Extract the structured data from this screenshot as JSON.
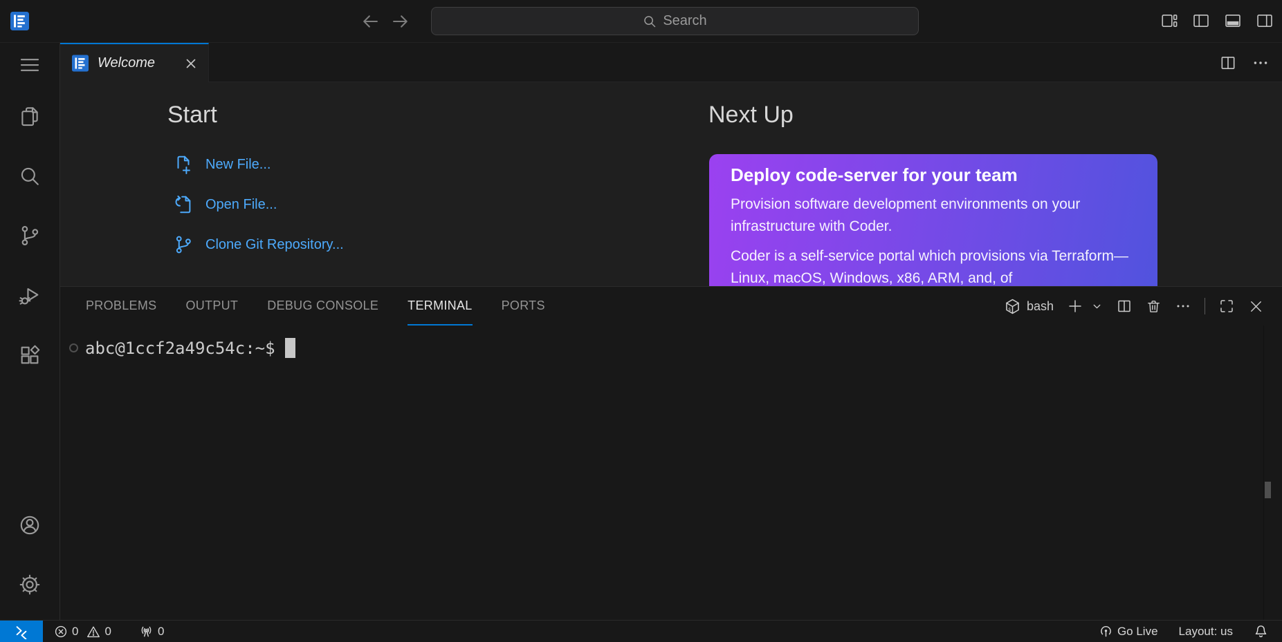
{
  "titlebar": {
    "search_label": "Search",
    "window_controls": [
      "customize-layout",
      "toggle-primary-sidebar",
      "toggle-panel",
      "toggle-secondary-sidebar"
    ]
  },
  "activity_bar": {
    "items": [
      "menu",
      "explorer",
      "search",
      "source-control",
      "run-and-debug",
      "extensions"
    ],
    "bottom_items": [
      "accounts",
      "settings"
    ]
  },
  "editor": {
    "tab": {
      "label": "Welcome"
    }
  },
  "welcome": {
    "start_heading": "Start",
    "start_links": [
      {
        "label": "New File...",
        "icon": "new-file-icon"
      },
      {
        "label": "Open File...",
        "icon": "open-file-icon"
      },
      {
        "label": "Clone Git Repository...",
        "icon": "git-branch-icon"
      }
    ],
    "next_up_heading": "Next Up",
    "card": {
      "title": "Deploy code-server for your team",
      "paragraph_1": "Provision software development environments on your infrastructure with Coder.",
      "paragraph_2": "Coder is a self-service portal which provisions via Terraform—Linux, macOS, Windows, x86, ARM, and, of"
    }
  },
  "panel": {
    "tabs": [
      {
        "label": "PROBLEMS",
        "active": false
      },
      {
        "label": "OUTPUT",
        "active": false
      },
      {
        "label": "DEBUG CONSOLE",
        "active": false
      },
      {
        "label": "TERMINAL",
        "active": true
      },
      {
        "label": "PORTS",
        "active": false
      }
    ],
    "shell_label": "bash"
  },
  "terminal": {
    "prompt": "abc@1ccf2a49c54c:~$"
  },
  "status_bar": {
    "errors": "0",
    "warnings": "0",
    "ports_count": "0",
    "go_live_label": "Go Live",
    "layout_label": "Layout: us"
  },
  "colors": {
    "background": "#181818",
    "editor_background": "#1f1f1f",
    "accent_blue": "#0078d4",
    "link_blue": "#4daafc",
    "remote_indicator": "#0078d4",
    "card_gradient_from": "#9b41f0",
    "card_gradient_to": "#5153de",
    "foreground": "#cccccc"
  }
}
